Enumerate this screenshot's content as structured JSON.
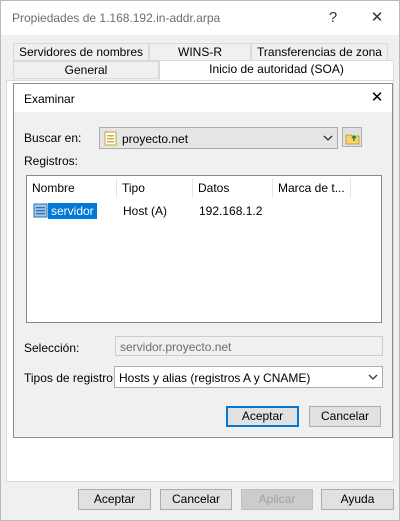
{
  "window": {
    "title": "Propiedades de 1.168.192.in-addr.arpa",
    "help_glyph": "?",
    "close_glyph": "✕"
  },
  "tabs": {
    "row1": [
      "Servidores de nombres",
      "WINS-R",
      "Transferencias de zona"
    ],
    "row2": [
      "General",
      "Inicio de autoridad (SOA)"
    ]
  },
  "dialog": {
    "title": "Examinar",
    "close_glyph": "✕",
    "lookin_label": "Buscar en:",
    "lookin_value": "proyecto.net",
    "records_label": "Registros:",
    "columns": [
      "Nombre",
      "Tipo",
      "Datos",
      "Marca de t..."
    ],
    "rows": [
      {
        "name": "servidor",
        "type": "Host (A)",
        "data": "192.168.1.2",
        "timestamp": ""
      }
    ],
    "selection_label": "Selección:",
    "selection_value": "servidor.proyecto.net",
    "record_types_label": "Tipos de registro:",
    "record_types_value": "Hosts y alias (registros A y CNAME)",
    "ok_label": "Aceptar",
    "cancel_label": "Cancelar"
  },
  "footer": {
    "ok_label": "Aceptar",
    "cancel_label": "Cancelar",
    "apply_label": "Aplicar",
    "help_label": "Ayuda"
  }
}
